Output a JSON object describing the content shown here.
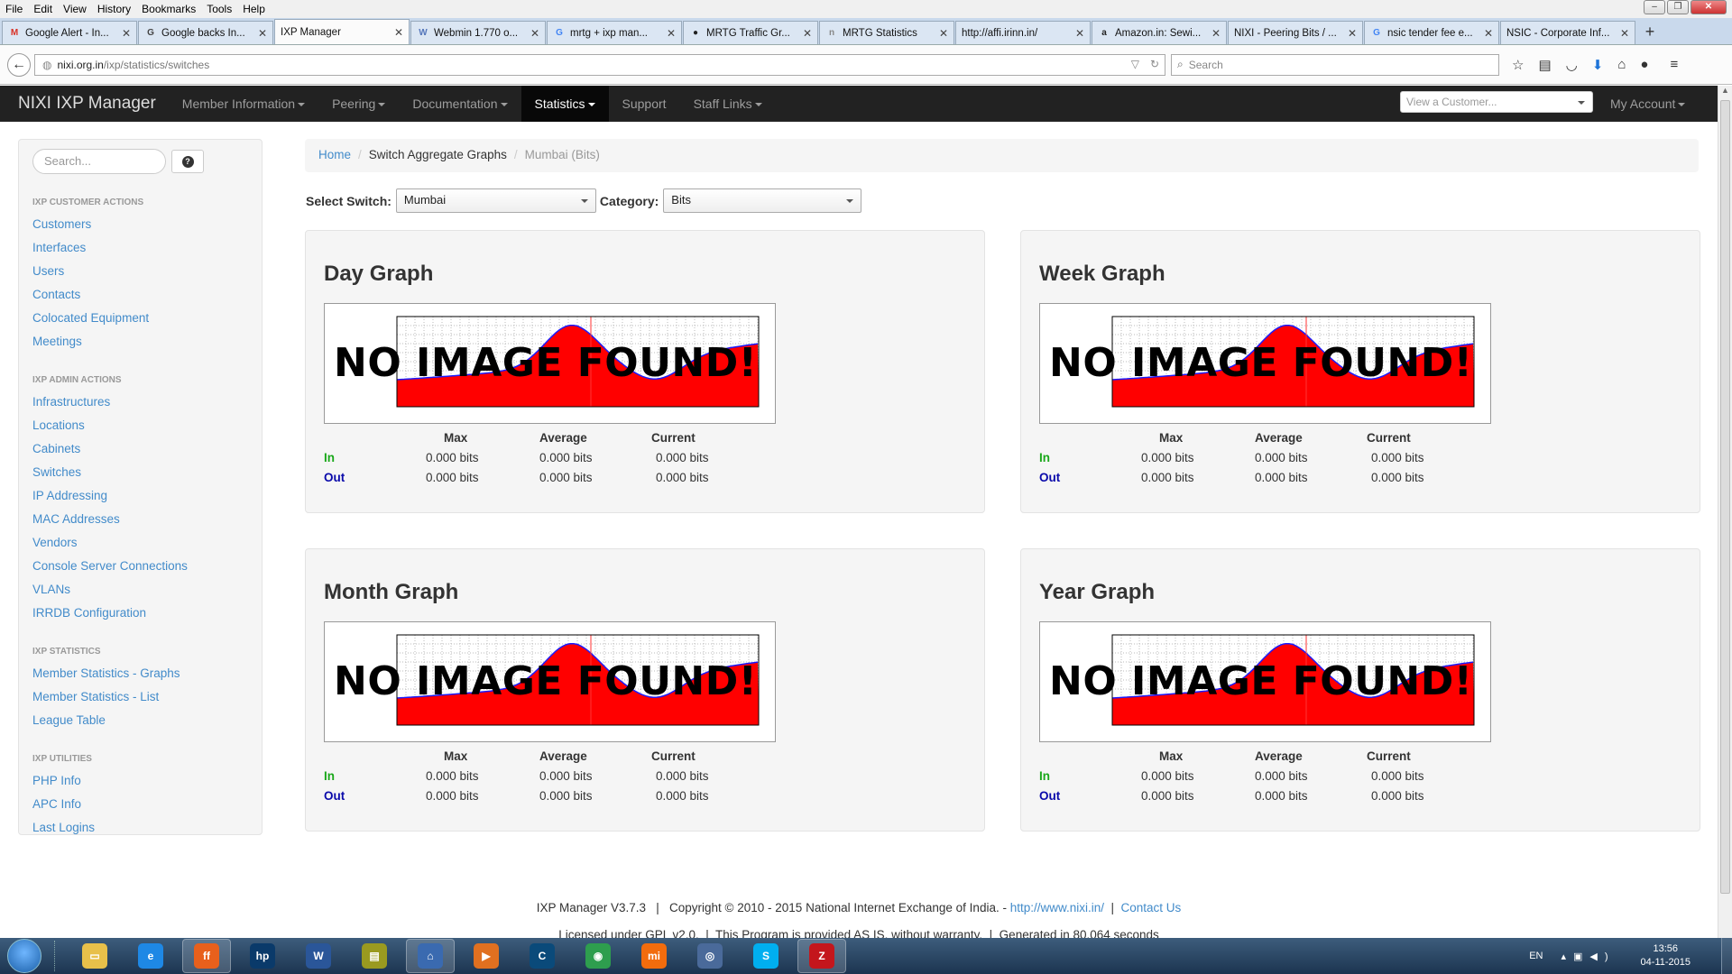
{
  "browser": {
    "menu": [
      "File",
      "Edit",
      "View",
      "History",
      "Bookmarks",
      "Tools",
      "Help"
    ],
    "tabs": [
      {
        "label": "Google Alert - In...",
        "icon": "gmail-icon",
        "color": "#d93025",
        "glyph": "M"
      },
      {
        "label": "Google backs In...",
        "icon": "site-icon",
        "color": "#444",
        "glyph": "G"
      },
      {
        "label": "IXP Manager",
        "icon": "",
        "color": "",
        "glyph": ""
      },
      {
        "label": "Webmin 1.770 o...",
        "icon": "webmin-icon",
        "color": "#5577bb",
        "glyph": "W"
      },
      {
        "label": "mrtg + ixp man...",
        "icon": "google-icon",
        "color": "#4285f4",
        "glyph": "G"
      },
      {
        "label": "MRTG Traffic Gr...",
        "icon": "github-icon",
        "color": "#222",
        "glyph": "●"
      },
      {
        "label": "MRTG Statistics",
        "icon": "nixi-icon",
        "color": "#888",
        "glyph": "n"
      },
      {
        "label": "http://affi.irinn.in/",
        "icon": "",
        "color": "",
        "glyph": ""
      },
      {
        "label": "Amazon.in: Sewi...",
        "icon": "amazon-icon",
        "color": "#222",
        "glyph": "a"
      },
      {
        "label": "NIXI - Peering Bits / ...",
        "icon": "",
        "color": "",
        "glyph": ""
      },
      {
        "label": "nsic tender fee e...",
        "icon": "google-icon",
        "color": "#4285f4",
        "glyph": "G"
      },
      {
        "label": "NSIC - Corporate Inf...",
        "icon": "",
        "color": "",
        "glyph": ""
      }
    ],
    "url_host": "nixi.org.in",
    "url_path": "/ixp/statistics/switches",
    "search_placeholder": "Search"
  },
  "app": {
    "brand": "NIXI IXP Manager",
    "nav": [
      "Member Information",
      "Peering",
      "Documentation",
      "Statistics",
      "Support",
      "Staff Links"
    ],
    "customer_placeholder": "View a Customer...",
    "my_account": "My Account"
  },
  "sidebar": {
    "search_placeholder": "Search...",
    "sections": [
      {
        "title": "IXP CUSTOMER ACTIONS",
        "items": [
          "Customers",
          "Interfaces",
          "Users",
          "Contacts",
          "Colocated Equipment",
          "Meetings"
        ]
      },
      {
        "title": "IXP ADMIN ACTIONS",
        "items": [
          "Infrastructures",
          "Locations",
          "Cabinets",
          "Switches",
          "IP Addressing",
          "MAC Addresses",
          "Vendors",
          "Console Server Connections",
          "VLANs",
          "IRRDB Configuration"
        ]
      },
      {
        "title": "IXP STATISTICS",
        "items": [
          "Member Statistics - Graphs",
          "Member Statistics - List",
          "League Table"
        ]
      },
      {
        "title": "IXP UTILITIES",
        "items": [
          "PHP Info",
          "APC Info",
          "Last Logins"
        ]
      }
    ]
  },
  "breadcrumb": {
    "home": "Home",
    "section": "Switch Aggregate Graphs",
    "current": "Mumbai (Bits)"
  },
  "filters": {
    "switch_label": "Select Switch:",
    "switch_value": "Mumbai",
    "category_label": "Category:",
    "category_value": "Bits"
  },
  "graphs": [
    {
      "title": "Day Graph"
    },
    {
      "title": "Week Graph"
    },
    {
      "title": "Month Graph"
    },
    {
      "title": "Year Graph"
    }
  ],
  "graph_placeholder": "NO IMAGE FOUND!",
  "stats": {
    "headers": [
      "Max",
      "Average",
      "Current"
    ],
    "in_label": "In",
    "out_label": "Out",
    "in_values": [
      "0.000 bits",
      "0.000 bits",
      "0.000 bits"
    ],
    "out_values": [
      "0.000 bits",
      "0.000 bits",
      "0.000 bits"
    ]
  },
  "footer": {
    "line1_pre": "IXP Manager V3.7.3   |   Copyright © 2010 - 2015 National Internet Exchange of India. - ",
    "link": "http://www.nixi.in/",
    "sep": "  |  ",
    "contact": "Contact Us",
    "line2": "Licensed under GPL v2.0.  |  This Program is provided AS IS, without warranty.  |  Generated in 80.064 seconds"
  },
  "taskbar": {
    "apps": [
      {
        "name": "explorer-icon",
        "color": "#e8c04a",
        "glyph": "▭"
      },
      {
        "name": "ie-icon",
        "color": "#1e88e5",
        "glyph": "e"
      },
      {
        "name": "firefox-icon",
        "color": "#e8601c",
        "glyph": "ff"
      },
      {
        "name": "hp-icon",
        "color": "#0a3a6a",
        "glyph": "hp"
      },
      {
        "name": "word-icon",
        "color": "#2a5699",
        "glyph": "W"
      },
      {
        "name": "app-icon",
        "color": "#9a9a20",
        "glyph": "▤"
      },
      {
        "name": "network-icon",
        "color": "#3a6ab0",
        "glyph": "⌂"
      },
      {
        "name": "media-icon",
        "color": "#e07020",
        "glyph": "▶"
      },
      {
        "name": "calc-icon",
        "color": "#0a4a7a",
        "glyph": "C"
      },
      {
        "name": "chrome-icon",
        "color": "#2e9e4e",
        "glyph": "◉"
      },
      {
        "name": "mi-icon",
        "color": "#f26c0d",
        "glyph": "mi"
      },
      {
        "name": "steam-icon",
        "color": "#4a6a9a",
        "glyph": "◎"
      },
      {
        "name": "skype-icon",
        "color": "#00aff0",
        "glyph": "S"
      },
      {
        "name": "filezilla-icon",
        "color": "#c4161c",
        "glyph": "Z"
      }
    ],
    "lang": "EN",
    "time": "13:56",
    "date": "04-11-2015"
  }
}
